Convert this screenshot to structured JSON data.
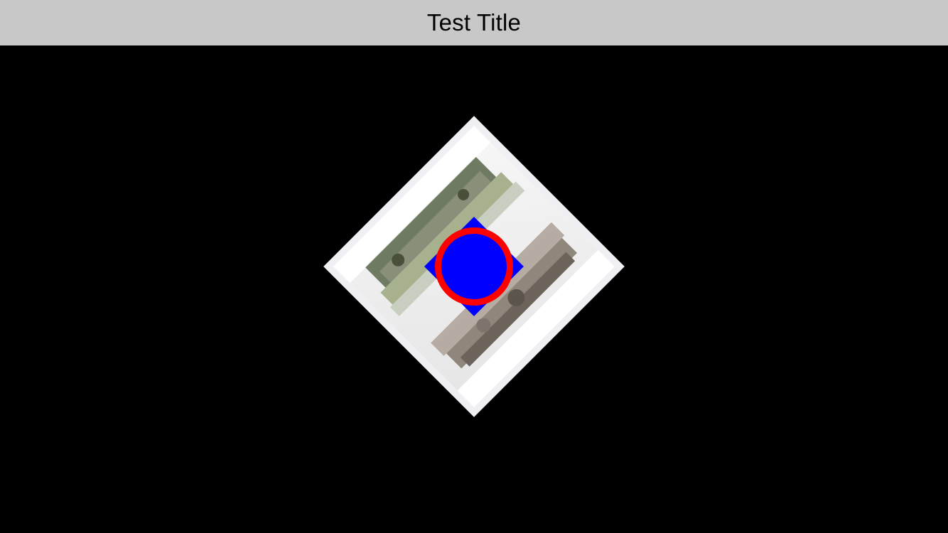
{
  "nav": {
    "title": "Test Title"
  },
  "colors": {
    "nav_background": "#c8c8c8",
    "content_background": "#000000",
    "frame_fill": "#efeff4",
    "photo_band": "#ffffff",
    "overlay_square": "#0000ff",
    "overlay_ring": "#ff0000",
    "overlay_circle": "#0000ff"
  },
  "image_view": {
    "rotation_degrees": 45,
    "content": "photo-with-overlay"
  }
}
